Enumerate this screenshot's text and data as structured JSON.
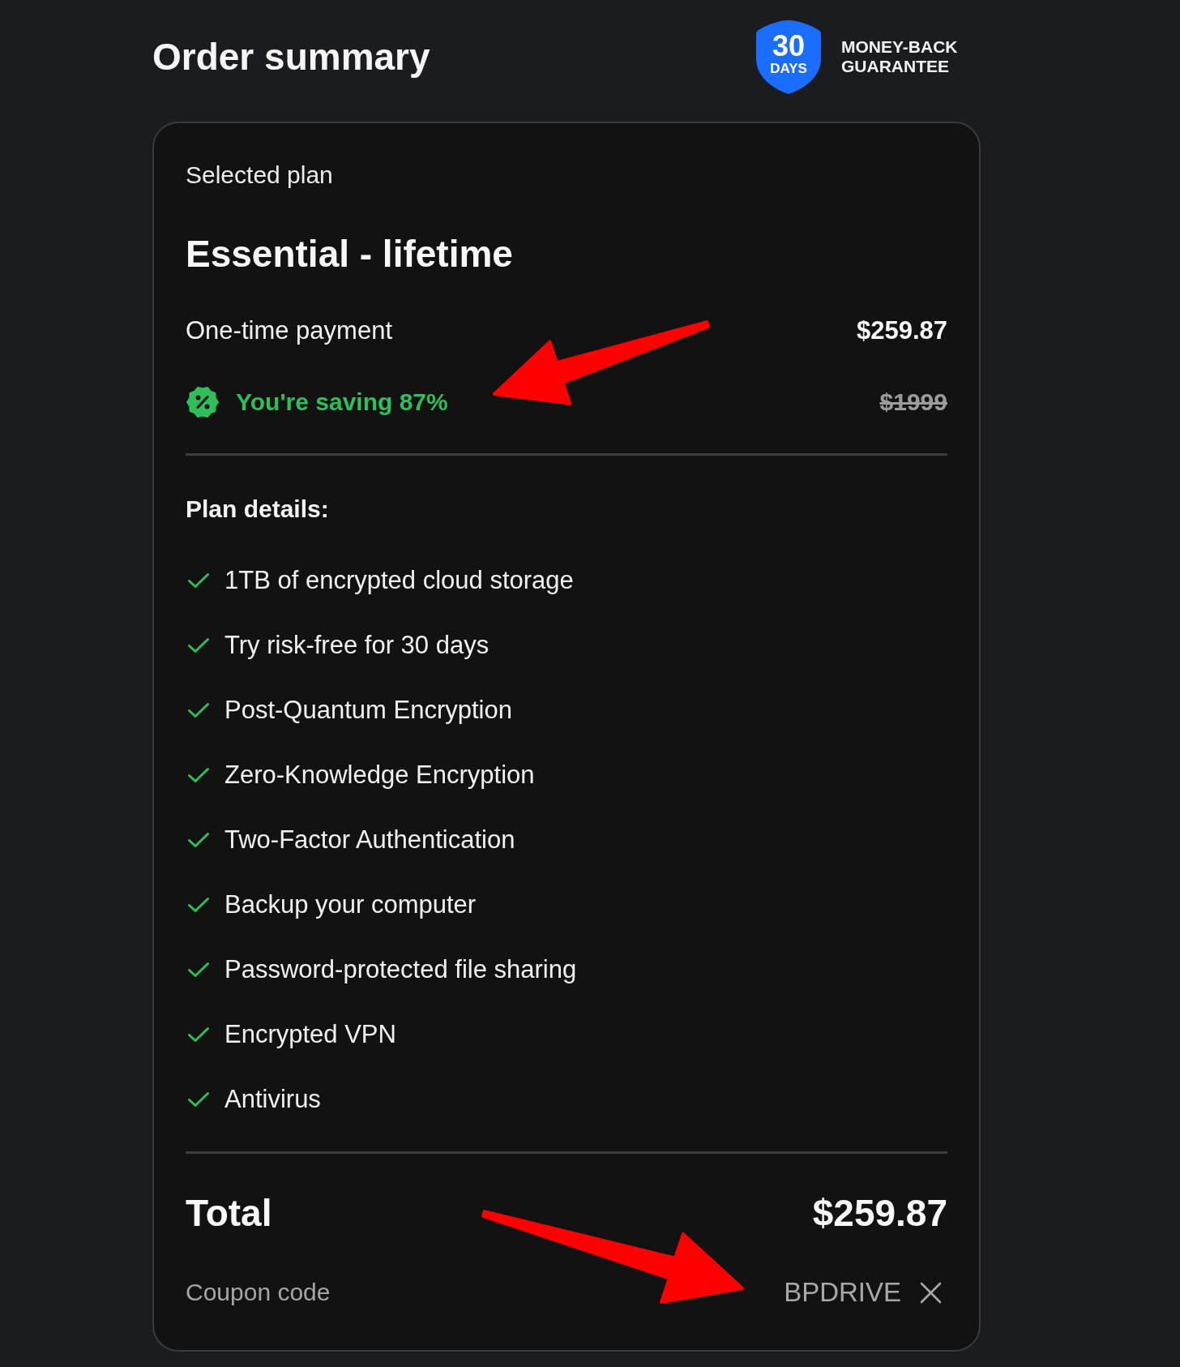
{
  "header": {
    "title": "Order summary",
    "guarantee_badge": {
      "days_number": "30",
      "days_label": "DAYS",
      "text": "MONEY-BACK GUARANTEE"
    }
  },
  "order": {
    "section_label": "Selected plan",
    "plan_name": "Essential - lifetime",
    "payment": {
      "label": "One-time payment",
      "price": "$259.87"
    },
    "saving": {
      "text": "You're saving 87%",
      "original_price": "$1999"
    },
    "plan_details": {
      "heading": "Plan details:",
      "features": [
        "1TB of encrypted cloud storage",
        "Try risk-free for 30 days",
        "Post-Quantum Encryption",
        "Zero-Knowledge Encryption",
        "Two-Factor Authentication",
        "Backup your computer",
        "Password-protected file sharing",
        "Encrypted VPN",
        "Antivirus"
      ]
    },
    "total": {
      "label": "Total",
      "amount": "$259.87"
    },
    "coupon": {
      "label": "Coupon code",
      "code": "BPDRIVE"
    }
  },
  "annotations": [
    {
      "kind": "arrow"
    },
    {
      "kind": "arrow"
    }
  ]
}
